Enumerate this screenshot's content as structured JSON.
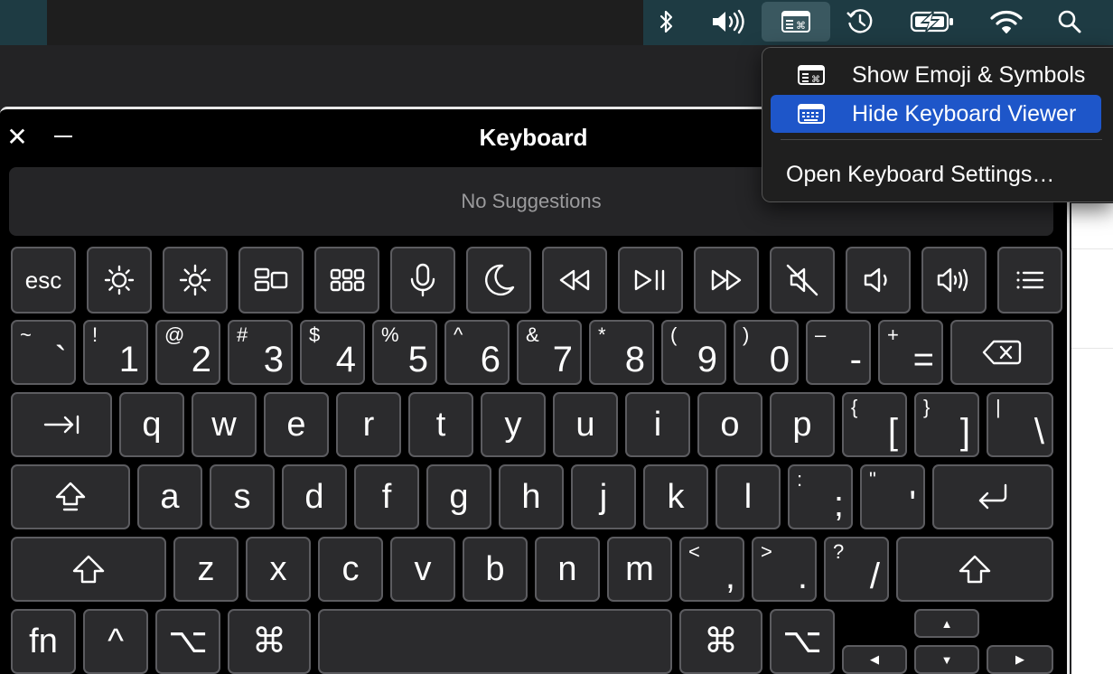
{
  "menubar": {
    "icons": [
      "bluetooth-icon",
      "volume-icon",
      "keyboard-viewer-icon",
      "time-machine-icon",
      "battery-charging-icon",
      "wifi-icon",
      "spotlight-search-icon"
    ]
  },
  "menu": {
    "items": [
      {
        "label": "Show Emoji & Symbols",
        "icon": "emoji-symbols-icon"
      },
      {
        "label": "Hide Keyboard Viewer",
        "icon": "keyboard-icon",
        "selected": true
      },
      {
        "label": "Open Keyboard Settings…"
      }
    ],
    "selected_color": "#1e56c9"
  },
  "keyboard_viewer": {
    "title": "Keyboard",
    "suggestions": "No Suggestions",
    "function_row": {
      "esc": "esc"
    },
    "number_row": [
      {
        "main": "`",
        "shift": "~"
      },
      {
        "main": "1",
        "shift": "!"
      },
      {
        "main": "2",
        "shift": "@"
      },
      {
        "main": "3",
        "shift": "#"
      },
      {
        "main": "4",
        "shift": "$"
      },
      {
        "main": "5",
        "shift": "%"
      },
      {
        "main": "6",
        "shift": "^"
      },
      {
        "main": "7",
        "shift": "&"
      },
      {
        "main": "8",
        "shift": "*"
      },
      {
        "main": "9",
        "shift": "("
      },
      {
        "main": "0",
        "shift": ")"
      },
      {
        "main": "-",
        "shift": "–"
      },
      {
        "main": "=",
        "shift": "+"
      }
    ],
    "top_row": [
      "q",
      "w",
      "e",
      "r",
      "t",
      "y",
      "u",
      "i",
      "o",
      "p"
    ],
    "top_row_symbols": [
      {
        "main": "[",
        "shift": "{"
      },
      {
        "main": "]",
        "shift": "}"
      },
      {
        "main": "\\",
        "shift": "|"
      }
    ],
    "home_row": [
      "a",
      "s",
      "d",
      "f",
      "g",
      "h",
      "j",
      "k",
      "l"
    ],
    "home_row_symbols": [
      {
        "main": ";",
        "shift": ":"
      },
      {
        "main": "'",
        "shift": "\""
      }
    ],
    "bottom_row": [
      "z",
      "x",
      "c",
      "v",
      "b",
      "n",
      "m"
    ],
    "bottom_row_symbols": [
      {
        "main": ",",
        "shift": "<"
      },
      {
        "main": ".",
        "shift": ">"
      },
      {
        "main": "/",
        "shift": "?"
      }
    ],
    "modifiers": {
      "fn": "fn",
      "control": "^",
      "option": "⌥",
      "command": "⌘"
    },
    "arrows": {
      "up": "▲",
      "left": "◀",
      "down": "▼",
      "right": "▶"
    }
  }
}
